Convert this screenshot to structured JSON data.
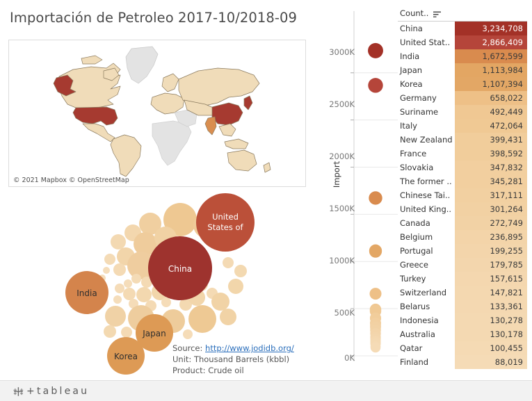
{
  "title": "Importación de Petroleo 2017-10/2018-09",
  "map": {
    "attribution": "© 2021 Mapbox  © OpenStreetMap",
    "highlight_colors": {
      "very_high": "#a63a30",
      "high": "#d98e50",
      "mid": "#edc999",
      "base": "#f0dcb9",
      "nodata": "#e3e3e3",
      "border": "#8a7a5e"
    }
  },
  "source_note": {
    "source_label": "Source: ",
    "source_url_text": "http://www.jodidb.org/",
    "unit": "Unit: Thousand Barrels (kbbl)",
    "product": "Product: Crude oil"
  },
  "axis": {
    "title": "Import",
    "ticks": [
      "3000K",
      "2500K",
      "2000K",
      "1500K",
      "1000K",
      "500K",
      "0K"
    ],
    "min": 0,
    "max": 3300000
  },
  "table": {
    "header": "Count..",
    "sort_icon": "sort-descending-icon",
    "columns": [
      "Country",
      "Import"
    ],
    "rows": [
      {
        "name": "China",
        "display_name": "China",
        "value": 3234708,
        "value_text": "3,234,708",
        "color": "#a33127",
        "text_color": "#ffffff"
      },
      {
        "name": "United States",
        "display_name": "United Stat..",
        "value": 2866409,
        "value_text": "2,866,409",
        "color": "#b5453a",
        "text_color": "#ffffff"
      },
      {
        "name": "India",
        "display_name": "India",
        "value": 1672599,
        "value_text": "1,672,599",
        "color": "#d98b4e",
        "text_color": "#3a3a3a"
      },
      {
        "name": "Japan",
        "display_name": "Japan",
        "value": 1113984,
        "value_text": "1,113,984",
        "color": "#e3a663",
        "text_color": "#3a3a3a"
      },
      {
        "name": "Korea",
        "display_name": "Korea",
        "value": 1107394,
        "value_text": "1,107,394",
        "color": "#e3a765",
        "text_color": "#3a3a3a"
      },
      {
        "name": "Germany",
        "display_name": "Germany",
        "value": 658022,
        "value_text": "658,022",
        "color": "#eec087",
        "text_color": "#3a3a3a"
      },
      {
        "name": "Suriname",
        "display_name": "Suriname",
        "value": 492449,
        "value_text": "492,449",
        "color": "#f0c893",
        "text_color": "#3a3a3a"
      },
      {
        "name": "Italy",
        "display_name": "Italy",
        "value": 472064,
        "value_text": "472,064",
        "color": "#f0c994",
        "text_color": "#3a3a3a"
      },
      {
        "name": "New Zealand",
        "display_name": "New Zealand",
        "value": 399431,
        "value_text": "399,431",
        "color": "#f1cd9b",
        "text_color": "#3a3a3a"
      },
      {
        "name": "France",
        "display_name": "France",
        "value": 398592,
        "value_text": "398,592",
        "color": "#f1cd9b",
        "text_color": "#3a3a3a"
      },
      {
        "name": "Slovakia",
        "display_name": "Slovakia",
        "value": 347832,
        "value_text": "347,832",
        "color": "#f2cf9f",
        "text_color": "#3a3a3a"
      },
      {
        "name": "The former Yugoslav Republic of Macedonia",
        "display_name": "The former ..",
        "value": 345281,
        "value_text": "345,281",
        "color": "#f2cf9f",
        "text_color": "#3a3a3a"
      },
      {
        "name": "Chinese Taipei",
        "display_name": "Chinese Tai..",
        "value": 317111,
        "value_text": "317,111",
        "color": "#f2d0a1",
        "text_color": "#3a3a3a"
      },
      {
        "name": "United Kingdom",
        "display_name": "United King..",
        "value": 301264,
        "value_text": "301,264",
        "color": "#f2d1a3",
        "text_color": "#3a3a3a"
      },
      {
        "name": "Canada",
        "display_name": "Canada",
        "value": 272749,
        "value_text": "272,749",
        "color": "#f2d2a5",
        "text_color": "#3a3a3a"
      },
      {
        "name": "Belgium",
        "display_name": "Belgium",
        "value": 236895,
        "value_text": "236,895",
        "color": "#f3d4a9",
        "text_color": "#3a3a3a"
      },
      {
        "name": "Portugal",
        "display_name": "Portugal",
        "value": 199255,
        "value_text": "199,255",
        "color": "#f3d5ab",
        "text_color": "#3a3a3a"
      },
      {
        "name": "Greece",
        "display_name": "Greece",
        "value": 179785,
        "value_text": "179,785",
        "color": "#f3d6ad",
        "text_color": "#3a3a3a"
      },
      {
        "name": "Turkey",
        "display_name": "Turkey",
        "value": 157615,
        "value_text": "157,615",
        "color": "#f4d7af",
        "text_color": "#3a3a3a"
      },
      {
        "name": "Switzerland",
        "display_name": "Switzerland",
        "value": 147821,
        "value_text": "147,821",
        "color": "#f4d8b0",
        "text_color": "#3a3a3a"
      },
      {
        "name": "Belarus",
        "display_name": "Belarus",
        "value": 133361,
        "value_text": "133,361",
        "color": "#f4d8b1",
        "text_color": "#3a3a3a"
      },
      {
        "name": "Indonesia",
        "display_name": "Indonesia",
        "value": 130278,
        "value_text": "130,278",
        "color": "#f4d9b2",
        "text_color": "#3a3a3a"
      },
      {
        "name": "Australia",
        "display_name": "Australia",
        "value": 130178,
        "value_text": "130,178",
        "color": "#f4d9b2",
        "text_color": "#3a3a3a"
      },
      {
        "name": "Qatar",
        "display_name": "Qatar",
        "value": 100455,
        "value_text": "100,455",
        "color": "#f5dab4",
        "text_color": "#3a3a3a"
      },
      {
        "name": "Finland",
        "display_name": "Finland",
        "value": 88019,
        "value_text": "88,019",
        "color": "#f5dbb6",
        "text_color": "#3a3a3a"
      }
    ]
  },
  "chart_data": {
    "type": "scatter",
    "title": "Importación de Petroleo 2017-10/2018-09",
    "ylabel": "Import",
    "xlabel": "",
    "ylim": [
      0,
      3300000
    ],
    "yticks": [
      0,
      500000,
      1000000,
      1500000,
      2000000,
      2500000,
      3000000
    ],
    "ytick_labels": [
      "0K",
      "500K",
      "1000K",
      "1500K",
      "2000K",
      "2500K",
      "3000K"
    ],
    "unit": "Thousand Barrels (kbbl)",
    "product": "Crude oil",
    "categories": [
      "China",
      "United States",
      "India",
      "Japan",
      "Korea",
      "Germany",
      "Suriname",
      "Italy",
      "New Zealand",
      "France",
      "Slovakia",
      "The former ..",
      "Chinese Taipei",
      "United Kingdom",
      "Canada",
      "Belgium",
      "Portugal",
      "Greece",
      "Turkey",
      "Switzerland",
      "Belarus",
      "Indonesia",
      "Australia",
      "Qatar",
      "Finland"
    ],
    "values": [
      3234708,
      2866409,
      1672599,
      1113984,
      1107394,
      658022,
      492449,
      472064,
      399431,
      398592,
      347832,
      345281,
      317111,
      301264,
      272749,
      236895,
      199255,
      179785,
      157615,
      147821,
      133361,
      130278,
      130178,
      100455,
      88019
    ],
    "colors": [
      "#a33127",
      "#b5453a",
      "#d98b4e",
      "#e3a663",
      "#e3a765",
      "#eec087",
      "#f0c893",
      "#f0c994",
      "#f1cd9b",
      "#f1cd9b",
      "#f2cf9f",
      "#f2cf9f",
      "#f2d0a1",
      "#f2d1a3",
      "#f2d2a5",
      "#f3d4a9",
      "#f3d5ab",
      "#f3d6ad",
      "#f4d7af",
      "#f4d8b0",
      "#f4d8b1",
      "#f4d9b2",
      "#f4d9b2",
      "#f5dab4",
      "#f5dbb6"
    ],
    "legend": "none",
    "grid": true
  },
  "bubbles": {
    "type": "packed-circles",
    "labeled": [
      {
        "label_line1": "United",
        "label_line2": "States of",
        "value": 2866409
      },
      {
        "label_line1": "China",
        "label_line2": "",
        "value": 3234708
      },
      {
        "label_line1": "India",
        "label_line2": "",
        "value": 1672599
      },
      {
        "label_line1": "Japan",
        "label_line2": "",
        "value": 1113984
      },
      {
        "label_line1": "Korea",
        "label_line2": "",
        "value": 1107394
      }
    ]
  },
  "footer": {
    "logo_text": "tableau",
    "logo_icon": "tableau-logo-icon",
    "plus": "+"
  }
}
